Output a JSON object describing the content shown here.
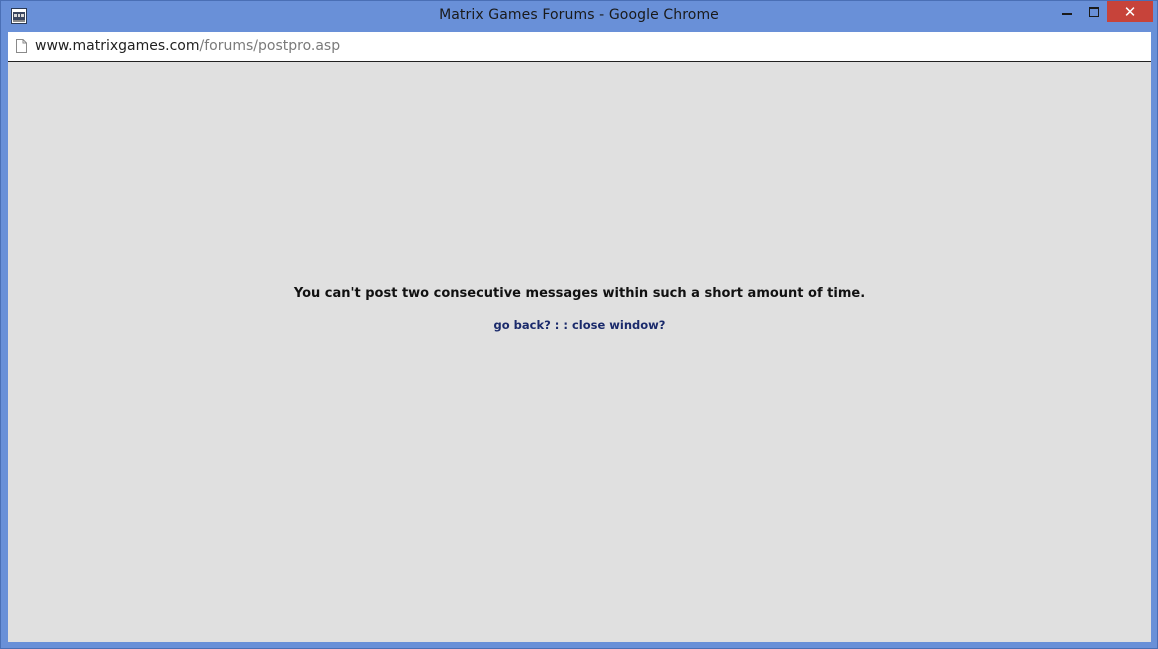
{
  "window": {
    "title": "Matrix Games Forums - Google Chrome",
    "icon": "matrix-games-app-icon",
    "controls": {
      "minimize_icon": "minimize-icon",
      "maximize_icon": "maximize-icon",
      "close_label": "✕"
    },
    "frame_color": "#6990d8",
    "close_color": "#c7433a"
  },
  "addressbar": {
    "icon": "page-icon",
    "url_host": "www.matrixgames.com",
    "url_path": "/forums/postpro.asp"
  },
  "page": {
    "background": "#e0e0e0",
    "message": "You can't post two consecutive messages within such a short amount of time.",
    "go_back_label": "go back?",
    "separator": " : : ",
    "close_window_label": "close window?",
    "link_color": "#1a2a6b"
  }
}
